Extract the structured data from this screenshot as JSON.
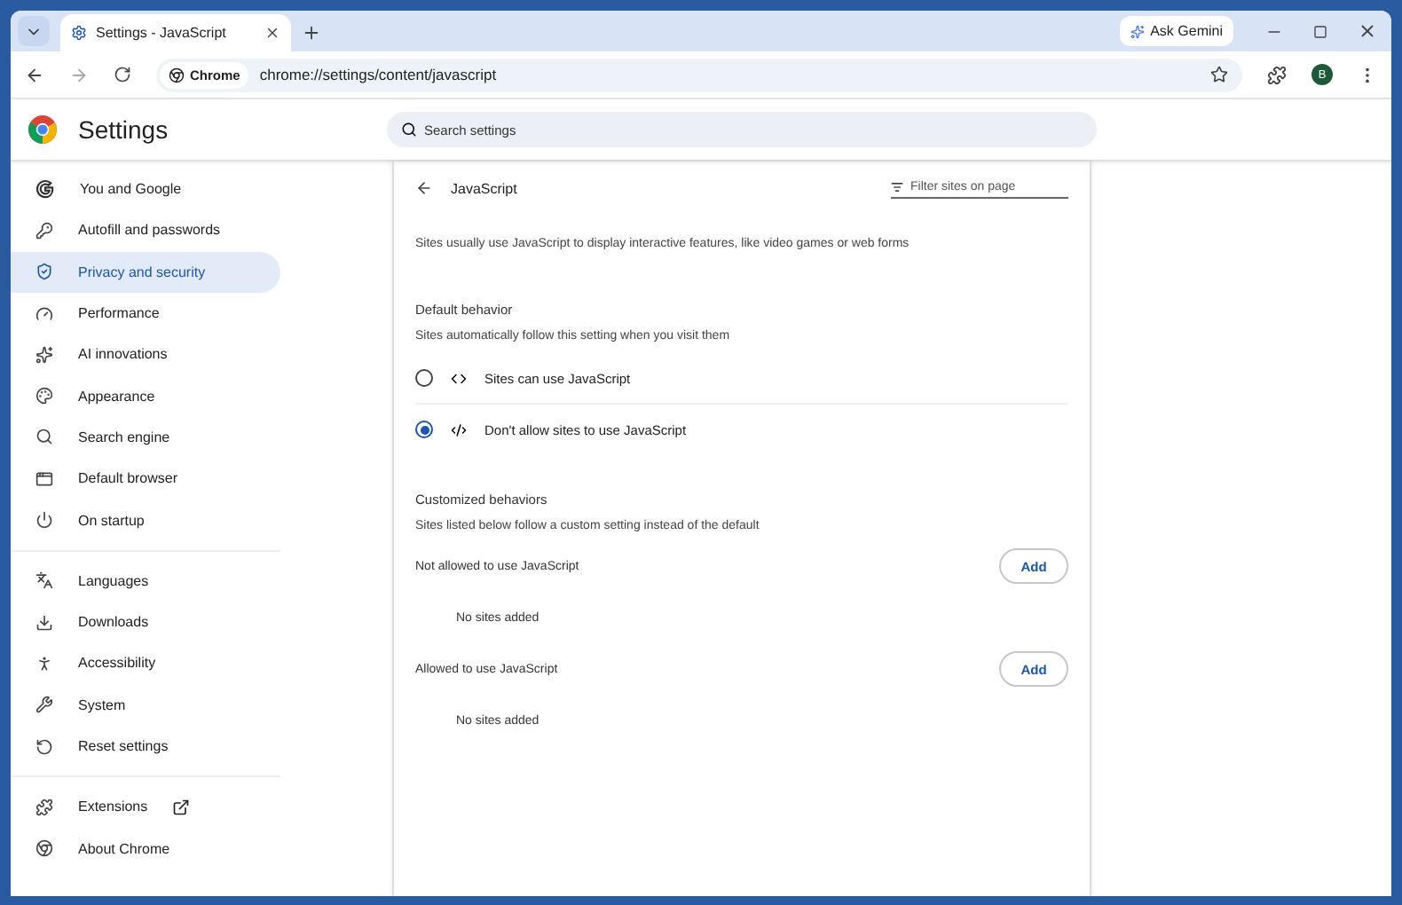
{
  "tabs": [
    {
      "title": "Settings - JavaScript",
      "selected": true
    }
  ],
  "ask_button": "Ask Gemini",
  "address_bar": {
    "chip": "Chrome",
    "url": "chrome://settings/content/javascript"
  },
  "profile_initial": "B",
  "header": {
    "title": "Settings",
    "search": {
      "placeholder": "Search settings"
    }
  },
  "sidebar": {
    "groups": [
      {
        "items": [
          {
            "label": "You and Google",
            "selected": false
          },
          {
            "label": "Autofill and passwords",
            "selected": false
          },
          {
            "label": "Privacy and security",
            "selected": true
          },
          {
            "label": "Performance",
            "selected": false
          },
          {
            "label": "AI innovations",
            "selected": false
          },
          {
            "label": "Appearance",
            "selected": false
          },
          {
            "label": "Search engine",
            "selected": false
          },
          {
            "label": "Default browser",
            "selected": false
          },
          {
            "label": "On startup",
            "selected": false
          }
        ]
      },
      {
        "items": [
          {
            "label": "Languages",
            "selected": false
          },
          {
            "label": "Downloads",
            "selected": false
          },
          {
            "label": "Accessibility",
            "selected": false
          },
          {
            "label": "System",
            "selected": false
          },
          {
            "label": "Reset settings",
            "selected": false
          }
        ]
      },
      {
        "items": [
          {
            "label": "Extensions",
            "selected": false,
            "kind": "external"
          },
          {
            "label": "About Chrome",
            "selected": false,
            "kind": "plain"
          }
        ]
      }
    ]
  },
  "page": {
    "title": "JavaScript",
    "filter": {
      "placeholder": "Filter sites on page"
    },
    "description": "Sites usually use JavaScript to display interactive features, like video games or web forms",
    "default_behavior": {
      "heading": "Default behavior",
      "subtitle": "Sites automatically follow this setting when you visit them",
      "options": [
        {
          "label": "Sites can use JavaScript",
          "kind": "allow",
          "selected": false
        },
        {
          "label": "Don't allow sites to use JavaScript",
          "kind": "block",
          "selected": true
        }
      ]
    },
    "customized": {
      "heading": "Customized behaviors",
      "subtitle": "Sites listed below follow a custom setting instead of the default",
      "lists": [
        {
          "title": "Not allowed to use JavaScript",
          "button": "Add",
          "empty": "No sites added"
        },
        {
          "title": "Allowed to use JavaScript",
          "button": "Add",
          "empty": "No sites added"
        }
      ]
    }
  }
}
